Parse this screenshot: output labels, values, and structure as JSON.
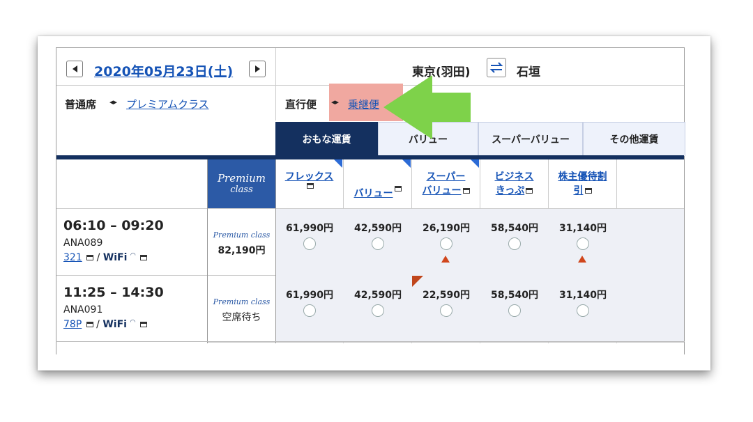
{
  "header": {
    "date": "2020年05月23日(土)",
    "route_from": "東京(羽田)",
    "route_to": "石垣",
    "swap_icon": "swap-arrows-icon"
  },
  "toggles": {
    "seat_current": "普通席",
    "seat_other": "プレミアムクラス",
    "flight_current": "直行便",
    "flight_other": "乗継便"
  },
  "tabs": [
    {
      "label": "おもな運賃",
      "active": true
    },
    {
      "label": "バリュー",
      "active": false
    },
    {
      "label": "スーパーバリュー",
      "active": false
    },
    {
      "label": "その他運賃",
      "active": false
    }
  ],
  "columns": {
    "premium_line1": "Premium",
    "premium_line2": "class",
    "fare_flex": "フレックス",
    "fare_value": "バリュー",
    "fare_super_1": "スーパー",
    "fare_super_2": "バリュー",
    "fare_business_1": "ビジネス",
    "fare_business_2": "きっぷ",
    "fare_shareholder_1": "株主優待割",
    "fare_shareholder_2": "引"
  },
  "flights": [
    {
      "time": "06:10 – 09:20",
      "flight_no": "ANA089",
      "aircraft": "321",
      "wifi": "WiFi",
      "premium_label": "Premium class",
      "premium_price": "82,190円",
      "prices": [
        "61,990円",
        "42,590円",
        "26,190円",
        "58,540円",
        "31,140円"
      ]
    },
    {
      "time": "11:25 – 14:30",
      "flight_no": "ANA091",
      "aircraft": "78P",
      "wifi": "WiFi",
      "premium_label": "Premium class",
      "premium_price": "空席待ち",
      "prices": [
        "61,990円",
        "42,590円",
        "22,590円",
        "58,540円",
        "31,140円"
      ]
    }
  ],
  "colors": {
    "navy": "#14305f",
    "premium_blue": "#2c5aa6",
    "link_blue": "#1553b6",
    "arrow_green": "#7ed24a",
    "highlight_red": "#f0a8a0",
    "warning_red": "#d0461c"
  }
}
